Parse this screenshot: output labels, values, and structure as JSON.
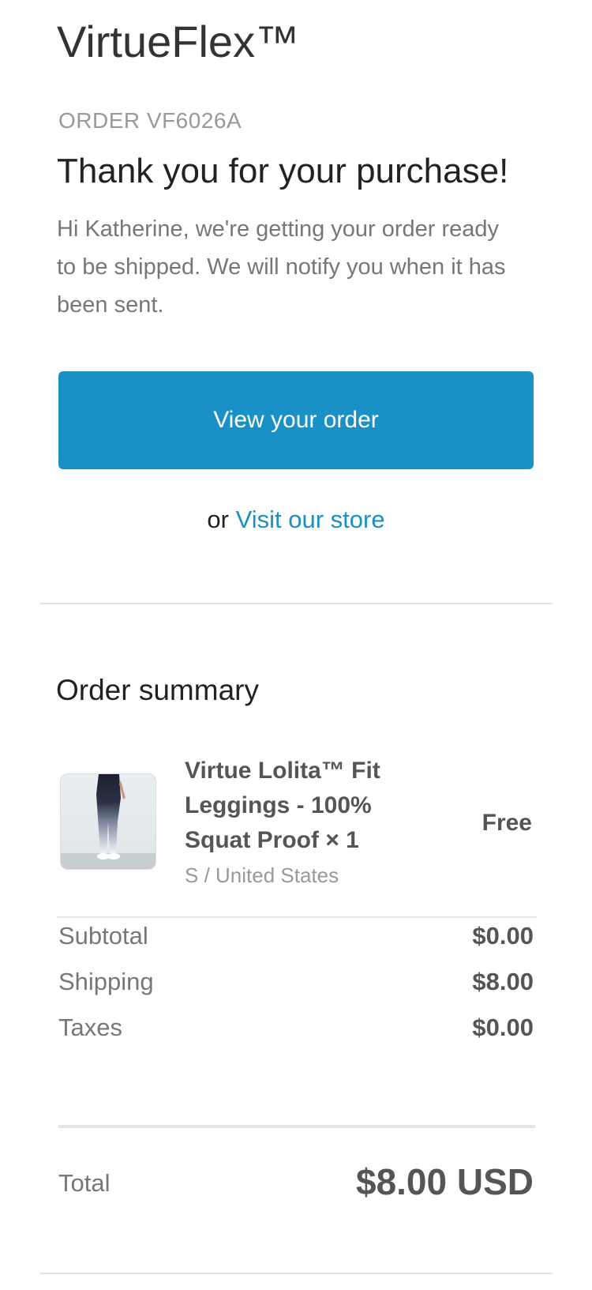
{
  "brand": "VirtueFlex™",
  "order_number": "ORDER VF6026A",
  "headline": "Thank you for your purchase!",
  "intro": "Hi Katherine, we're getting your order ready to be shipped. We will notify you when it has been sent.",
  "cta": {
    "label": "View your order",
    "or_text": "or",
    "store_link": "Visit our store"
  },
  "summary": {
    "title": "Order summary",
    "item": {
      "name": "Virtue Lolita™ Fit Leggings - 100% Squat Proof × 1",
      "variant": "S / United States",
      "price": "Free"
    },
    "costs": [
      {
        "label": "Subtotal",
        "value": "$0.00"
      },
      {
        "label": "Shipping",
        "value": "$8.00"
      },
      {
        "label": "Taxes",
        "value": "$0.00"
      }
    ],
    "total": {
      "label": "Total",
      "value": "$8.00 USD"
    }
  },
  "colors": {
    "accent": "#1990c6",
    "text_dark": "#222222",
    "text_muted": "#777777",
    "divider": "#e5e5e5"
  }
}
